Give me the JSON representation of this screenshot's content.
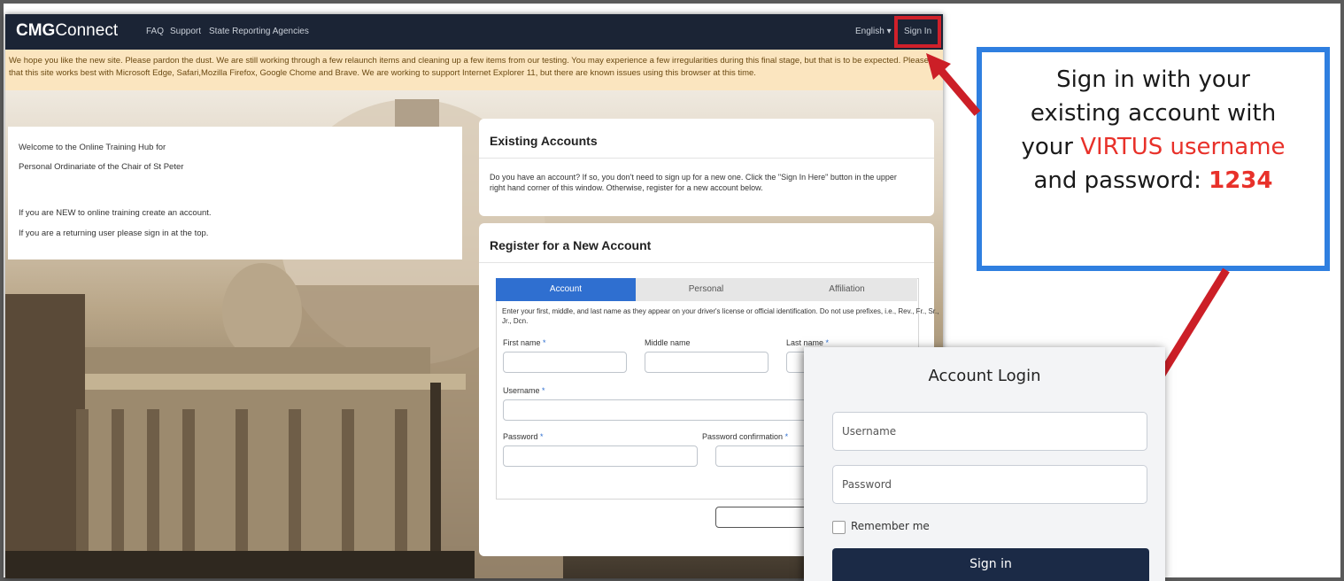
{
  "site": {
    "brand_bold": "CMG",
    "brand_rest": "Connect",
    "nav": [
      "FAQ",
      "Support",
      "State Reporting Agencies"
    ],
    "language": "English",
    "sign_in": "Sign In"
  },
  "alert": {
    "line1": "We hope you like the new site. Please pardon the dust. We are still working through a few relaunch items and cleaning up a few items from our testing. You may experience a few irregularities during this final stage, but that is to be expected. Please r",
    "line2": "that this site works best with Microsoft Edge, Safari,Mozilla Firefox, Google Chome and Brave. We are working to support Internet Explorer 11, but there are known issues using this browser at this time."
  },
  "welcome": {
    "line1": "Welcome to the Online Training Hub for",
    "line2": "Personal Ordinariate of the Chair of St Peter",
    "line3": "If you are NEW to online training create an account.",
    "line4": "If you are a returning user please sign in at the top."
  },
  "existing": {
    "title": "Existing Accounts",
    "text1": "Do you have an account? If so, you don't need to sign up for a new one. Click the \"Sign In Here\" button in the upper",
    "text2": "right hand corner of this window. Otherwise, register for a new account below."
  },
  "register": {
    "title": "Register for a New Account",
    "tabs": [
      "Account",
      "Personal",
      "Affiliation"
    ],
    "instructions1": "Enter your first, middle, and last name as they appear on your driver's license or official identification. Do not use prefixes, i.e., Rev., Fr., Sr.,",
    "instructions2": "Jr., Dcn.",
    "first_name": "First name",
    "middle_name": "Middle name",
    "last_name": "Last name",
    "username": "Username",
    "password": "Password",
    "password_confirmation": "Password confirmation",
    "required_mark": "*",
    "next_partial": "N"
  },
  "callout": {
    "line1": "Sign in with your",
    "line2": "existing account with",
    "line3_a": "your ",
    "line3_b": "VIRTUS username",
    "line4_a": "and password: ",
    "line4_b": "1234"
  },
  "login": {
    "title": "Account Login",
    "username_placeholder": "Username",
    "password_placeholder": "Password",
    "remember": "Remember me",
    "button": "Sign in"
  },
  "colors": {
    "navbar": "#1b2435",
    "alert_bg": "#fbe5bf",
    "tab_active": "#2f6fd0",
    "callout_border": "#2f7fe0",
    "highlight_red": "#e8312a",
    "arrow_red": "#cc1f27",
    "login_button": "#1b2a46"
  }
}
